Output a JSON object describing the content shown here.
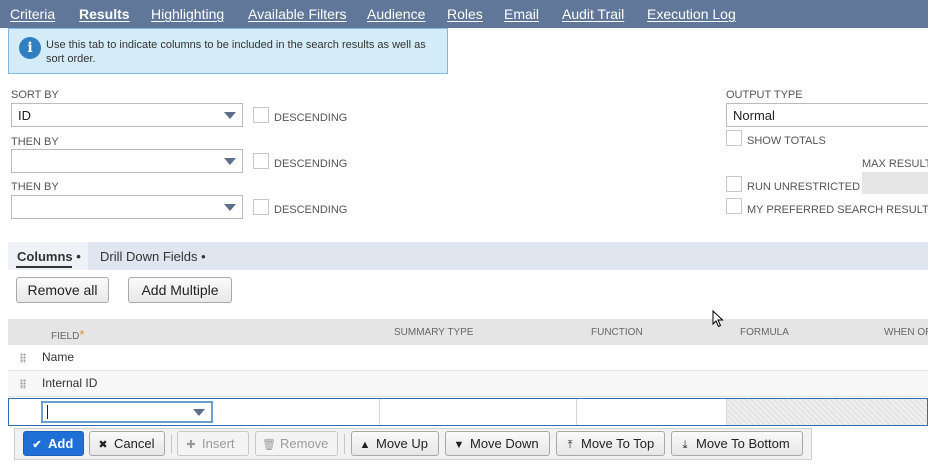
{
  "tabs": [
    {
      "label": "Criteria",
      "active": false
    },
    {
      "label": "Results",
      "active": true
    },
    {
      "label": "Highlighting",
      "active": false
    },
    {
      "label": "Available Filters",
      "active": false
    },
    {
      "label": "Audience",
      "active": false
    },
    {
      "label": "Roles",
      "active": false
    },
    {
      "label": "Email",
      "active": false
    },
    {
      "label": "Audit Trail",
      "active": false
    },
    {
      "label": "Execution Log",
      "active": false
    }
  ],
  "info": {
    "icon": "info-icon",
    "text": "Use this tab to indicate columns to be included in the search results as well as sort order."
  },
  "sort": {
    "sort_by_label": "SORT BY",
    "sort_by_value": "ID",
    "then_by_label_1": "THEN BY",
    "then_by_value_1": "",
    "then_by_label_2": "THEN BY",
    "then_by_value_2": "",
    "descending_label": "DESCENDING"
  },
  "options": {
    "output_type_label": "OUTPUT TYPE",
    "output_type_value": "Normal",
    "show_totals_label": "SHOW TOTALS",
    "max_results_label": "MAX RESULT",
    "run_unrestricted_label": "RUN UNRESTRICTED",
    "preferred_label": "MY PREFERRED SEARCH RESULTS"
  },
  "subtabs": [
    {
      "label": "Columns •",
      "active": true
    },
    {
      "label": "Drill Down Fields •",
      "active": false
    }
  ],
  "buttons": {
    "remove_all": "Remove all",
    "add_multiple": "Add Multiple"
  },
  "grid": {
    "columns": [
      "FIELD",
      "SUMMARY TYPE",
      "FUNCTION",
      "FORMULA",
      "WHEN OR"
    ],
    "required_mark": "*",
    "rows": [
      "Name",
      "Internal ID"
    ]
  },
  "toolbar": {
    "add": "Add",
    "cancel": "Cancel",
    "insert": "Insert",
    "remove": "Remove",
    "move_up": "Move Up",
    "move_down": "Move Down",
    "move_to_top": "Move To Top",
    "move_to_bottom": "Move To Bottom"
  },
  "colors": {
    "tabbar": "#607799",
    "primary_button": "#1e6fd6",
    "info_background": "#d4ecf8"
  }
}
